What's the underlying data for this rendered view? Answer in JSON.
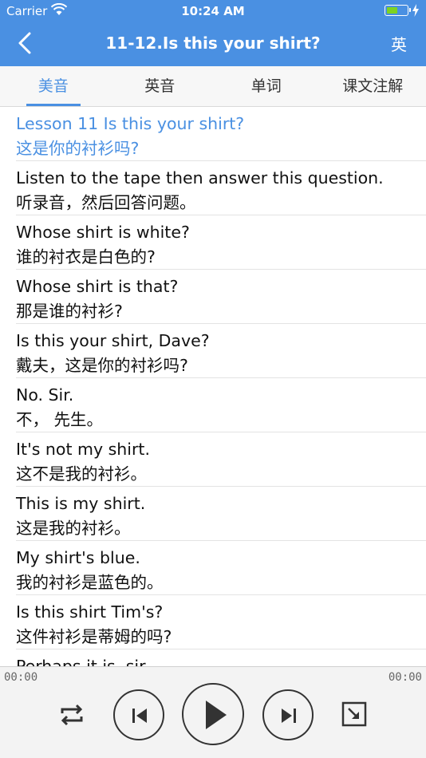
{
  "status": {
    "carrier": "Carrier",
    "time": "10:24 AM",
    "battery_level": 0.55
  },
  "nav": {
    "title": "11-12.Is this your shirt?",
    "lang_toggle": "英"
  },
  "tabs": [
    {
      "label": "美音"
    },
    {
      "label": "英音"
    },
    {
      "label": "单词"
    },
    {
      "label": "课文注解"
    }
  ],
  "active_tab": 0,
  "items": [
    {
      "en": "Lesson 11 Is this your shirt?",
      "zh": "这是你的衬衫吗?"
    },
    {
      "en": "Listen to the tape then answer this question.",
      "zh": "听录音，然后回答问题。"
    },
    {
      "en": "Whose shirt is white?",
      "zh": "谁的衬衣是白色的?"
    },
    {
      "en": "Whose shirt is that?",
      "zh": "那是谁的衬衫?"
    },
    {
      "en": "Is this your shirt, Dave?",
      "zh": "戴夫，这是你的衬衫吗?"
    },
    {
      "en": "No. Sir.",
      "zh": "不， 先生。"
    },
    {
      "en": "It's not my shirt.",
      "zh": "这不是我的衬衫。"
    },
    {
      "en": "This is my shirt.",
      "zh": "这是我的衬衫。"
    },
    {
      "en": "My shirt's blue.",
      "zh": "我的衬衫是蓝色的。"
    },
    {
      "en": "Is this shirt Tim's?",
      "zh": "这件衬衫是蒂姆的吗?"
    },
    {
      "en": "Perhaps it is, sir.",
      "zh": ""
    }
  ],
  "highlight_index": 0,
  "player": {
    "current_time": "00:00",
    "total_time": "00:00"
  },
  "icons": {
    "back": "chevron-left-icon",
    "repeat": "repeat-icon",
    "previous": "skip-previous-icon",
    "play": "play-icon",
    "next": "skip-next-icon",
    "shrink": "shrink-icon"
  },
  "colors": {
    "accent": "#4a90e2",
    "battery": "#7ed321"
  }
}
